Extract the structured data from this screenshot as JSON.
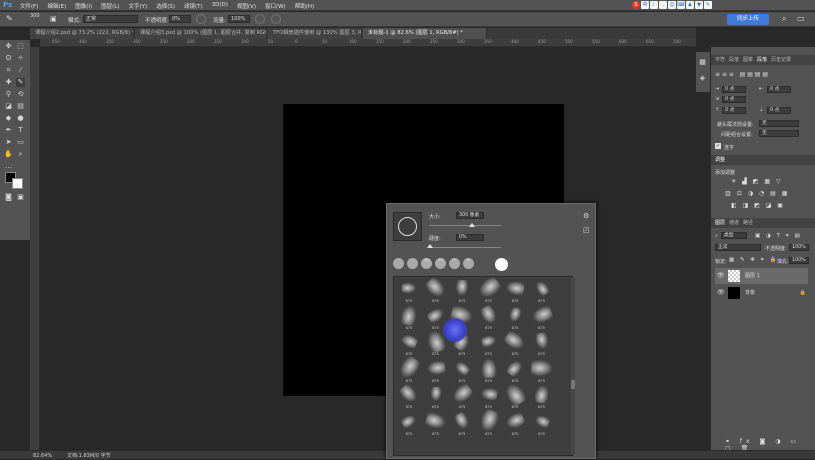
{
  "app": {
    "logo": "Ps"
  },
  "menubar": {
    "items": [
      "文件(F)",
      "编辑(E)",
      "图像(I)",
      "图层(L)",
      "文字(Y)",
      "选择(S)",
      "滤镜(T)",
      "3D(D)",
      "视图(V)",
      "窗口(W)",
      "帮助(H)"
    ]
  },
  "options": {
    "brush_size": "300",
    "mode_label": "模式:",
    "mode_value": "正常",
    "opacity_label": "不透明度:",
    "opacity_value": "0%",
    "flow_label": "流量:",
    "flow_value": "100%",
    "login_button": "同步上传"
  },
  "tabs": [
    {
      "label": "课程介绍2.psd @ 73.2% (222, RGB/8) *"
    },
    {
      "label": "课程介绍3.psd @ 100% (图层 1, 图层合并, 复制 RGB/8)*"
    },
    {
      "label": "TFO相册插件使用 @ 130% 图层 3, RGB/8"
    },
    {
      "label": "未标题-1 @ 82.6% (图层 1, RGB/8#) *"
    }
  ],
  "ruler": {
    "marks": [
      "450",
      "400",
      "350",
      "300",
      "250",
      "200",
      "150",
      "100",
      "50",
      "0",
      "50",
      "100",
      "150",
      "200",
      "250",
      "300",
      "350",
      "400",
      "450",
      "500",
      "550",
      "600",
      "650",
      "700"
    ]
  },
  "status": {
    "zoom": "82.64%",
    "doc": "文档:1.83M/0 字节"
  },
  "panel": {
    "tabs_top": [
      "字符",
      "段落",
      "图章",
      "段落",
      "历史记录"
    ],
    "kerning_a": "0 点",
    "kerning_b": "0 点",
    "tracking_a": "0 点",
    "tracking_b": "0 点",
    "spacing_a": "0 点",
    "spacing_b": "0 点",
    "setting1_label": "避头尾法则设置:",
    "setting1_value": "无",
    "setting2_label": "间距组合设置:",
    "setting2_value": "无",
    "hyphen_label": "连字",
    "adjust_title": "调整",
    "add_adjust": "添加调整",
    "layers_tabs": [
      "图层",
      "通道",
      "路径"
    ],
    "filter_label": "类型",
    "blend_mode": "正常",
    "opacity_label": "不透明度:",
    "opacity_value": "100%",
    "lock_label": "锁定:",
    "fill_label": "填充:",
    "fill_value": "100%",
    "layers": [
      {
        "name": "图层 1"
      },
      {
        "name": "背景"
      }
    ]
  },
  "brushpicker": {
    "size_label": "大小:",
    "size_value": "300 像素",
    "hardness_label": "硬度:",
    "hardness_value": "0%",
    "presets": [
      "",
      "",
      "25",
      "13",
      "7",
      "9",
      ""
    ],
    "brush_number": "675"
  }
}
